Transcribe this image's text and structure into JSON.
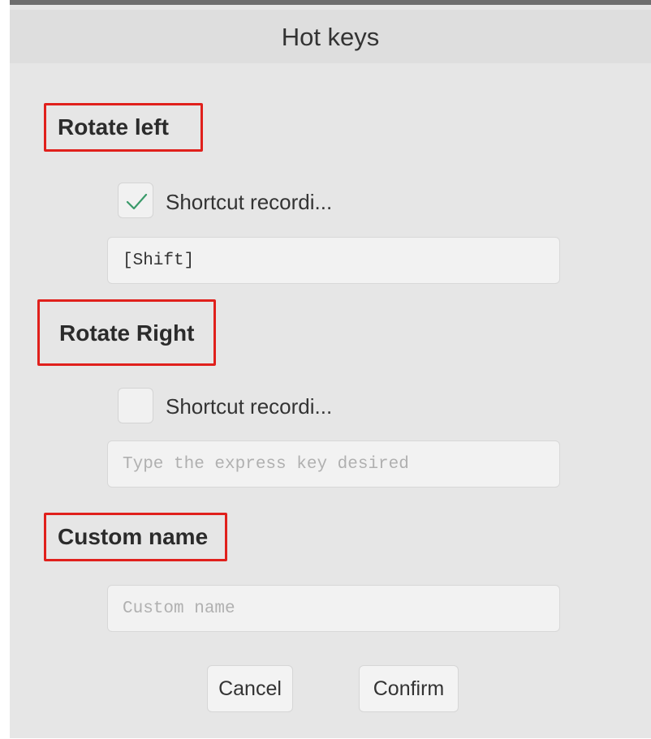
{
  "dialog": {
    "title": "Hot keys"
  },
  "rotate_left": {
    "label": "Rotate left",
    "checkbox_label": "Shortcut recordi...",
    "checked": true,
    "value": "[Shift]",
    "placeholder": ""
  },
  "rotate_right": {
    "label": "Rotate Right",
    "checkbox_label": "Shortcut recordi...",
    "checked": false,
    "value": "",
    "placeholder": "Type the express key desired"
  },
  "custom_name": {
    "label": "Custom name",
    "value": "",
    "placeholder": "Custom name"
  },
  "buttons": {
    "cancel": "Cancel",
    "confirm": "Confirm"
  },
  "colors": {
    "highlight_border": "#e0201c",
    "checkmark": "#3a9a6a",
    "dialog_bg": "#e6e6e6"
  },
  "icons": {
    "check": "check-icon"
  }
}
